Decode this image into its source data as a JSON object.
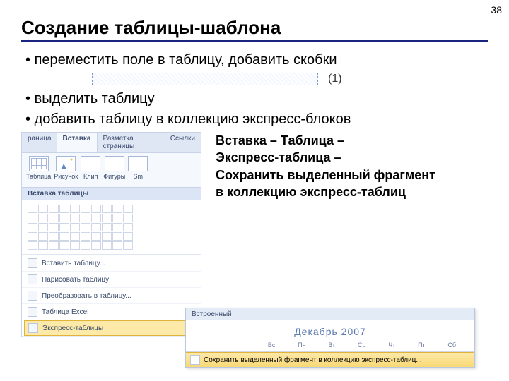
{
  "page_number": "38",
  "title": "Создание таблицы-шаблона",
  "bullets": {
    "b1": "переместить поле в таблицу, добавить скобки",
    "b2": "выделить таблицу",
    "b3": "добавить таблицу в коллекцию экспресс-блоков"
  },
  "field_paren": "(1)",
  "instruction": {
    "l1": "Вставка – Таблица –",
    "l2": "Экспресс-таблица –",
    "l3": "Сохранить выделенный фрагмент",
    "l4": "в коллекцию экспресс-таблиц"
  },
  "ribbon": {
    "tabs": {
      "page": "раница",
      "insert": "Вставка",
      "layout": "Разметка страницы",
      "refs": "Ссылки"
    },
    "btns": {
      "tabl": "Таблица",
      "pic": "Рисунок",
      "clip": "Клип",
      "fig": "Фигуры",
      "sm": "Sm"
    },
    "dropdown_head": "Вставка таблицы",
    "menu": {
      "insert": "Вставить таблицу...",
      "draw": "Нарисовать таблицу",
      "convert": "Преобразовать в таблицу...",
      "excel": "Таблица Excel",
      "express": "Экспресс-таблицы"
    }
  },
  "submenu": {
    "head": "Встроенный",
    "cal_title": "Декабрь 2007",
    "days": {
      "d1": "Вс",
      "d2": "Пн",
      "d3": "Вт",
      "d4": "Ср",
      "d5": "Чт",
      "d6": "Пт",
      "d7": "Сб"
    },
    "save": "Сохранить выделенный фрагмент в коллекцию экспресс-таблиц..."
  }
}
